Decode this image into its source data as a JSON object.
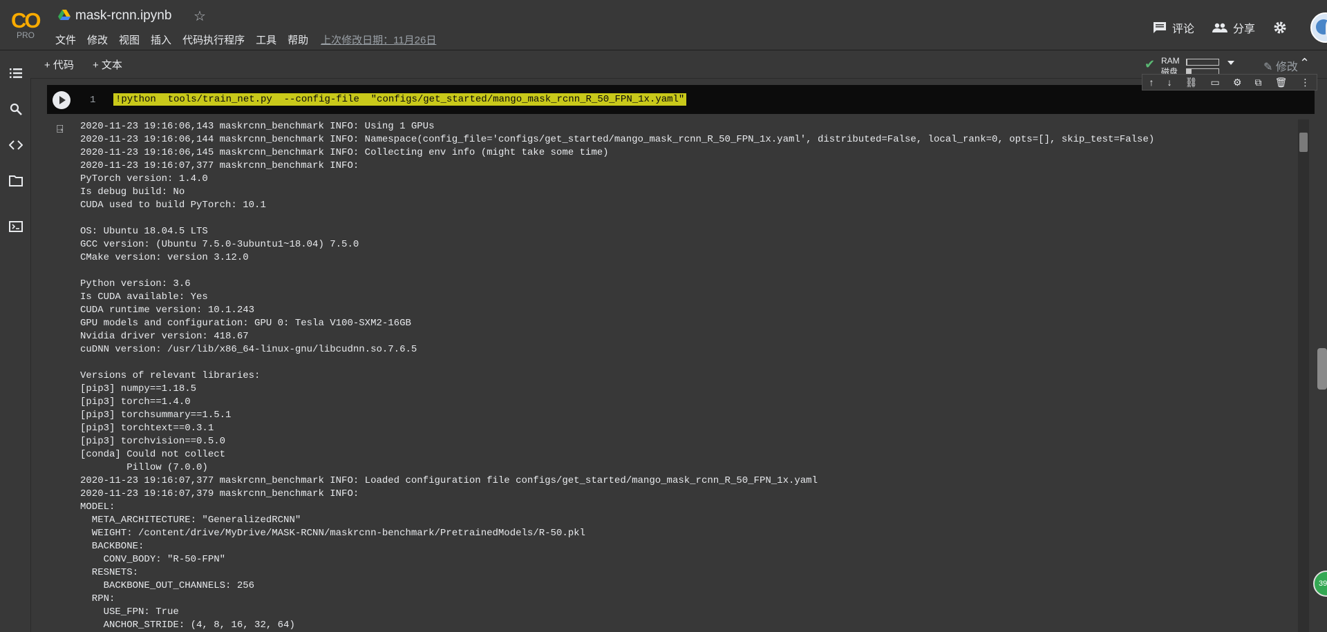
{
  "header": {
    "logo_text": "CO",
    "logo_sub": "PRO",
    "title": "mask-rcnn.ipynb",
    "menu": [
      "文件",
      "修改",
      "视图",
      "插入",
      "代码执行程序",
      "工具",
      "帮助"
    ],
    "last_edit": "上次修改日期：11月26日",
    "comment_label": "评论",
    "share_label": "分享"
  },
  "toolbar": {
    "add_code": "+ 代码",
    "add_text": "+ 文本",
    "ram_label": "RAM",
    "disk_label": "磁盘",
    "ram_usage": 0.02,
    "disk_usage": 0.15,
    "edit_label": "修改"
  },
  "cell": {
    "line_number": "1",
    "code": "!python  tools/train_net.py  --config-file  \"configs/get_started/mango_mask_rcnn_R_50_FPN_1x.yaml\"",
    "output_lines": [
      "2020-11-23 19:16:06,143 maskrcnn_benchmark INFO: Using 1 GPUs",
      "2020-11-23 19:16:06,144 maskrcnn_benchmark INFO: Namespace(config_file='configs/get_started/mango_mask_rcnn_R_50_FPN_1x.yaml', distributed=False, local_rank=0, opts=[], skip_test=False)",
      "2020-11-23 19:16:06,145 maskrcnn_benchmark INFO: Collecting env info (might take some time)",
      "2020-11-23 19:16:07,377 maskrcnn_benchmark INFO:",
      "PyTorch version: 1.4.0",
      "Is debug build: No",
      "CUDA used to build PyTorch: 10.1",
      "",
      "OS: Ubuntu 18.04.5 LTS",
      "GCC version: (Ubuntu 7.5.0-3ubuntu1~18.04) 7.5.0",
      "CMake version: version 3.12.0",
      "",
      "Python version: 3.6",
      "Is CUDA available: Yes",
      "CUDA runtime version: 10.1.243",
      "GPU models and configuration: GPU 0: Tesla V100-SXM2-16GB",
      "Nvidia driver version: 418.67",
      "cuDNN version: /usr/lib/x86_64-linux-gnu/libcudnn.so.7.6.5",
      "",
      "Versions of relevant libraries:",
      "[pip3] numpy==1.18.5",
      "[pip3] torch==1.4.0",
      "[pip3] torchsummary==1.5.1",
      "[pip3] torchtext==0.3.1",
      "[pip3] torchvision==0.5.0",
      "[conda] Could not collect",
      "        Pillow (7.0.0)",
      "2020-11-23 19:16:07,377 maskrcnn_benchmark INFO: Loaded configuration file configs/get_started/mango_mask_rcnn_R_50_FPN_1x.yaml",
      "2020-11-23 19:16:07,379 maskrcnn_benchmark INFO:",
      "MODEL:",
      "  META_ARCHITECTURE: \"GeneralizedRCNN\"",
      "  WEIGHT: /content/drive/MyDrive/MASK-RCNN/maskrcnn-benchmark/PretrainedModels/R-50.pkl",
      "  BACKBONE:",
      "    CONV_BODY: \"R-50-FPN\"",
      "  RESNETS:",
      "    BACKBONE_OUT_CHANNELS: 256",
      "  RPN:",
      "    USE_FPN: True",
      "    ANCHOR_STRIDE: (4, 8, 16, 32, 64)"
    ]
  },
  "badge_text": "39",
  "colors": {
    "background": "#383838",
    "code_bg": "#0c0c0c",
    "selection_highlight": "#c9c91a",
    "logo_orange": "#f9ab00",
    "ok_green": "#5bb974"
  }
}
